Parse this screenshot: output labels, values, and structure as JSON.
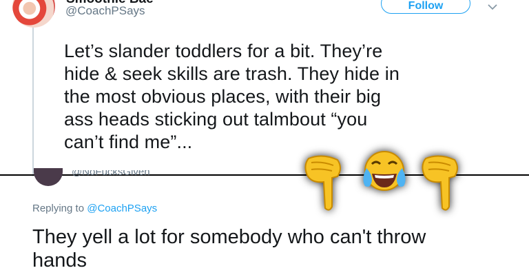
{
  "tweet": {
    "display_name": "Smoothie Bae",
    "handle": "@CoachPSays",
    "follow_label": "Follow",
    "caret_icon": "chevron-down-icon",
    "text_lines": [
      "Let’s slander toddlers for a bit. They’re",
      "hide & seek skills are trash. They hide in",
      "the most obvious places, with their big",
      "ass heads sticking out talmbout “you",
      "can’t find me”..."
    ]
  },
  "reply": {
    "handle_cut": "@NoFucksGiven",
    "replying_prefix": "Replying to",
    "replying_to": "@CoachPSays",
    "text_lines": [
      "They yell a lot for somebody who can't throw",
      "hands"
    ]
  },
  "emojis": [
    "pointing-down-icon",
    "tears-of-joy-icon",
    "pointing-down-icon"
  ],
  "colors": {
    "accent": "#1da1f2",
    "text": "#14171a",
    "muted": "#657786",
    "emoji_yellow": "#f7c325"
  }
}
